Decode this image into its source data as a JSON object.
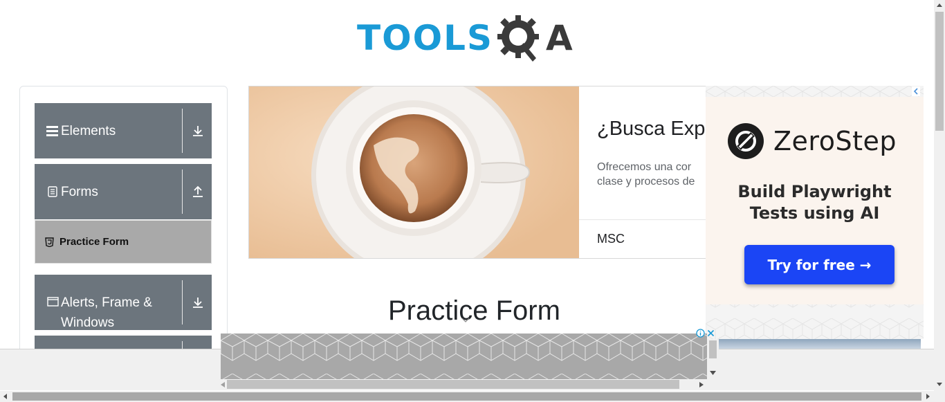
{
  "colors": {
    "sidebar_header": "#6c757d",
    "sidebar_active": "#a9a9a9",
    "logo_blue": "#1a9ad6",
    "logo_dark": "#3a3a3a",
    "cta_blue": "#1b45f5"
  },
  "header": {
    "logo_text_part1": "TOOLS",
    "logo_text_part2": "A"
  },
  "sidebar": {
    "groups": [
      {
        "label": "Elements",
        "icon": "hamburger-icon",
        "arrow": "download-arrow-icon"
      },
      {
        "label": "Forms",
        "icon": "document-icon",
        "arrow": "upload-arrow-icon"
      },
      {
        "label": "Alerts, Frame & Windows",
        "icon": "window-icon",
        "arrow": "download-arrow-icon"
      }
    ],
    "items": [
      {
        "label": "Practice Form",
        "icon": "html5-icon"
      }
    ]
  },
  "ad_main": {
    "title": "¿Busca Expo",
    "body_line1": "Ofrecemos una cor",
    "body_line2": "clase y procesos de",
    "brand": "MSC"
  },
  "main": {
    "heading": "Practice Form"
  },
  "ad_side": {
    "brand": "ZeroStep",
    "tagline_line1": "Build Playwright",
    "tagline_line2": "Tests using AI",
    "cta": "Try for free →"
  }
}
